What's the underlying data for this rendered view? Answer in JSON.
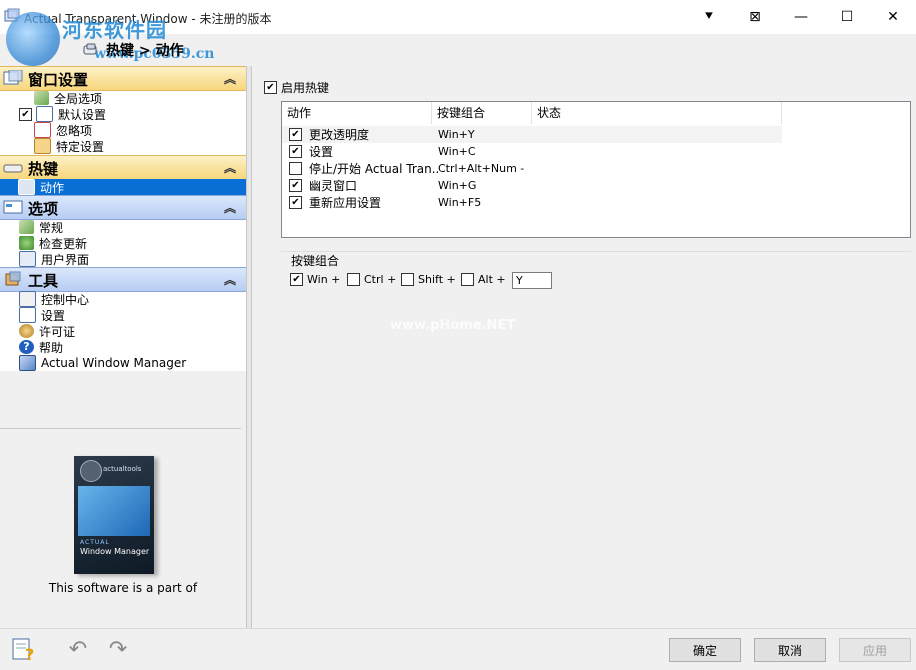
{
  "window": {
    "title": "Actual Transparent Window - 未注册的版本",
    "watermark_site": "河东软件园",
    "watermark_url": "www.pc0359.cn",
    "controls": {
      "pin": "⯆",
      "extra": "⊠",
      "minimize": "—",
      "maximize": "☐",
      "close": "✕"
    }
  },
  "breadcrumb": "热键 > 动作",
  "sidebar": {
    "sections": [
      {
        "title": "窗口设置",
        "items": [
          {
            "label": "全局选项"
          },
          {
            "label": "默认设置",
            "checked": true
          },
          {
            "label": "忽略项"
          },
          {
            "label": "特定设置"
          }
        ]
      },
      {
        "title": "热键",
        "items": [
          {
            "label": "动作",
            "selected": true
          }
        ]
      },
      {
        "title": "选项",
        "items": [
          {
            "label": "常规"
          },
          {
            "label": "检查更新"
          },
          {
            "label": "用户界面"
          }
        ]
      },
      {
        "title": "工具",
        "items": [
          {
            "label": "控制中心"
          },
          {
            "label": "设置"
          },
          {
            "label": "许可证"
          },
          {
            "label": "帮助"
          },
          {
            "label": "Actual Window Manager"
          }
        ]
      }
    ],
    "product": {
      "brand": "actualtools",
      "line1": "ACTUAL",
      "line2": "Window Manager"
    },
    "promo_text": "This software is a part of"
  },
  "hotkeys": {
    "enable_label": "启用热键",
    "enabled": true,
    "columns": [
      "动作",
      "按键组合",
      "状态"
    ],
    "rows": [
      {
        "checked": true,
        "action": "更改透明度",
        "keys": "Win+Y"
      },
      {
        "checked": true,
        "action": "设置",
        "keys": "Win+C"
      },
      {
        "checked": false,
        "action": "停止/开始 Actual Tran...",
        "keys": "Ctrl+Alt+Num -"
      },
      {
        "checked": true,
        "action": "幽灵窗口",
        "keys": "Win+G"
      },
      {
        "checked": true,
        "action": "重新应用设置",
        "keys": "Win+F5"
      }
    ]
  },
  "key_combo": {
    "title": "按键组合",
    "win": {
      "label": "Win +",
      "checked": true
    },
    "ctrl": {
      "label": "Ctrl +",
      "checked": false
    },
    "shift": {
      "label": "Shift +",
      "checked": false
    },
    "alt": {
      "label": "Alt +",
      "checked": false
    },
    "key": "Y"
  },
  "panel_watermark": "www.pHome.NET",
  "buttons": {
    "ok": "确定",
    "cancel": "取消",
    "apply": "应用"
  },
  "check_glyph": "✔"
}
